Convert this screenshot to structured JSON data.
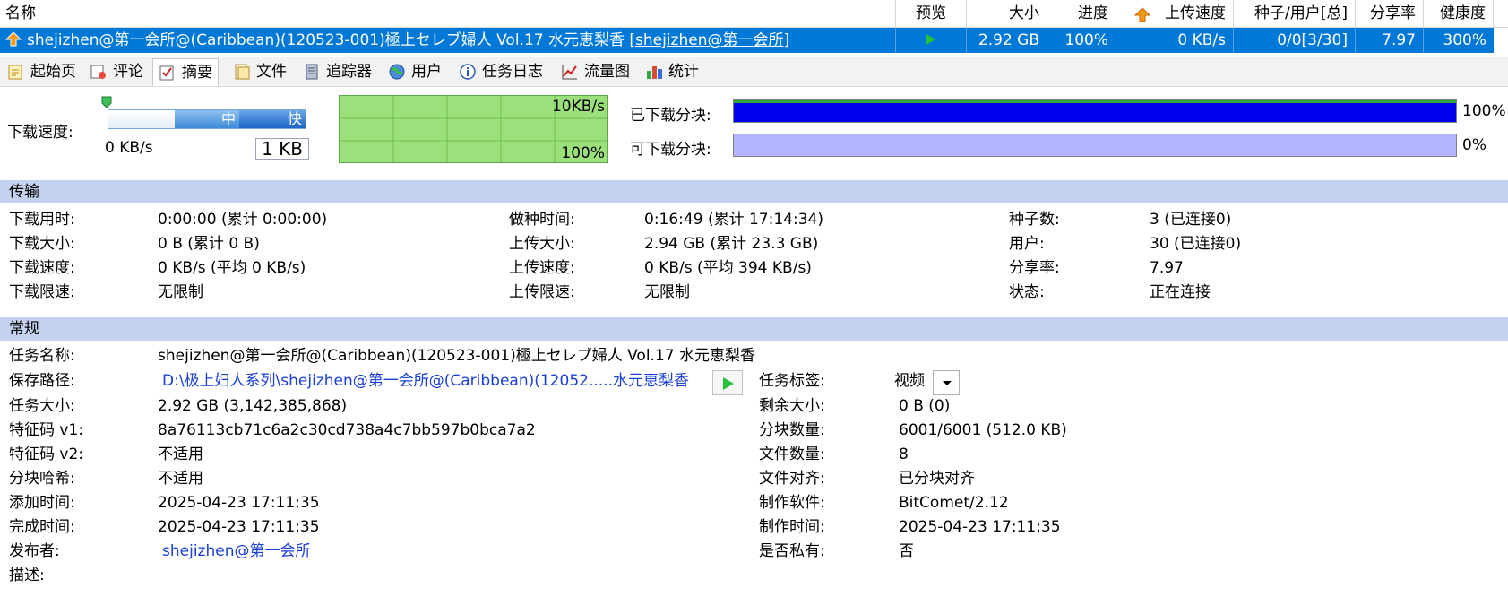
{
  "columns": {
    "name": "名称",
    "preview": "预览",
    "size": "大小",
    "progress": "进度",
    "upload_speed": "上传速度",
    "seeds_peers": "种子/用户[总]",
    "share_ratio": "分享率",
    "health": "健康度"
  },
  "torrent": {
    "name": "shejizhen@第一会所@(Caribbean)(120523-001)極上セレブ婦人 Vol.17 水元恵梨香",
    "publisher_tag": "[shejizhen@第一会所]",
    "size": "2.92 GB",
    "progress": "100%",
    "upload_speed": "0 KB/s",
    "seeds_peers": "0/0[3/30]",
    "share_ratio": "7.97",
    "health": "300%"
  },
  "tabs": [
    "起始页",
    "评论",
    "摘要",
    "文件",
    "追踪器",
    "用户",
    "任务日志",
    "流量图",
    "统计"
  ],
  "speed": {
    "label": "下载速度:",
    "current": "0 KB/s",
    "slider_mid": "中",
    "slider_fast": "快",
    "limit_box": "1 KB",
    "graph_max": "10KB/s",
    "graph_pct": "100%"
  },
  "pieces": {
    "downloaded_label": "已下载分块:",
    "downloaded_pct": "100%",
    "downloaded_fraction": 1.0,
    "available_label": "可下载分块:",
    "available_pct": "0%",
    "available_fraction": 0.0
  },
  "transfer": {
    "title": "传输",
    "rows": [
      {
        "k1": "下载用时:",
        "v1": "0:00:00 (累计 0:00:00)",
        "k2": "做种时间:",
        "v2": "0:16:49 (累计 17:14:34)",
        "k3": "种子数:",
        "v3": "3 (已连接0)"
      },
      {
        "k1": "下载大小:",
        "v1": "0 B (累计 0 B)",
        "k2": "上传大小:",
        "v2": "2.94 GB (累计 23.3 GB)",
        "k3": "用户:",
        "v3": "30 (已连接0)"
      },
      {
        "k1": "下载速度:",
        "v1": "0 KB/s (平均 0 KB/s)",
        "k2": "上传速度:",
        "v2": "0 KB/s (平均 394 KB/s)",
        "k3": "分享率:",
        "v3": "7.97"
      },
      {
        "k1": "下载限速:",
        "v1": "无限制",
        "k2": "上传限速:",
        "v2": "无限制",
        "k3": "状态:",
        "v3": "正在连接"
      }
    ]
  },
  "general": {
    "title": "常规",
    "task_name_label": "任务名称:",
    "task_name": "shejizhen@第一会所@(Caribbean)(120523-001)極上セレブ婦人 Vol.17 水元恵梨香",
    "save_path_label": "保存路径:",
    "save_path": "D:\\极上妇人系列\\shejizhen@第一会所@(Caribbean)(12052.....水元恵梨香",
    "tag_label": "任务标签:",
    "tag_value": "视频",
    "left": [
      {
        "k": "任务大小:",
        "v": "2.92 GB (3,142,385,868)"
      },
      {
        "k": "特征码 v1:",
        "v": "8a76113cb71c6a2c30cd738a4c7bb597b0bca7a2"
      },
      {
        "k": "特征码 v2:",
        "v": "不适用"
      },
      {
        "k": "分块哈希:",
        "v": "不适用"
      },
      {
        "k": "添加时间:",
        "v": "2025-04-23 17:11:35"
      },
      {
        "k": "完成时间:",
        "v": "2025-04-23 17:11:35"
      },
      {
        "k": "发布者:",
        "v": "shejizhen@第一会所"
      },
      {
        "k": "描述:",
        "v": ""
      }
    ],
    "right": [
      {
        "k": "剩余大小:",
        "v": "0 B (0)"
      },
      {
        "k": "分块数量:",
        "v": "6001/6001 (512.0 KB)"
      },
      {
        "k": "文件数量:",
        "v": "8"
      },
      {
        "k": "文件对齐:",
        "v": "已分块对齐"
      },
      {
        "k": "制作软件:",
        "v": "BitComet/2.12"
      },
      {
        "k": "制作时间:",
        "v": "2025-04-23 17:11:35"
      },
      {
        "k": "是否私有:",
        "v": "否"
      }
    ]
  },
  "colors": {
    "selection": "#0078d7",
    "section_band": "#c5d2ef",
    "graph_green": "#9be07a",
    "downloaded_bar": "#0000ee",
    "available_bar": "#b4b4ff",
    "link": "#1a3fd6"
  }
}
